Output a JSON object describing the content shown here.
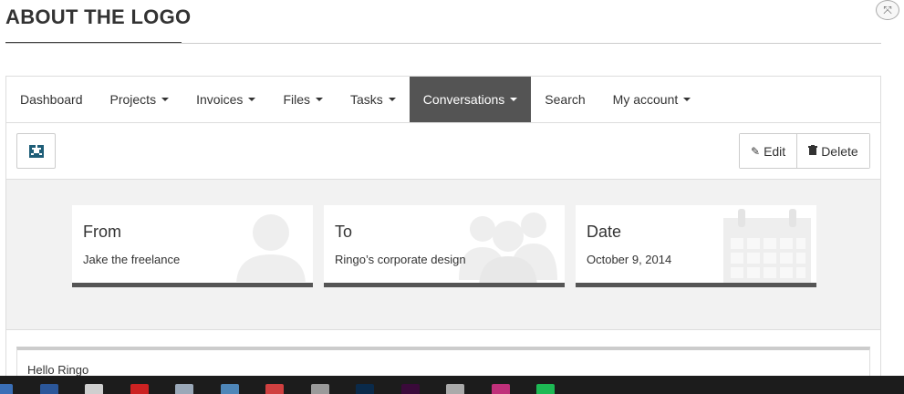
{
  "page": {
    "title": "ABOUT THE LOGO"
  },
  "nav": {
    "items": [
      {
        "label": "Dashboard",
        "dropdown": false,
        "active": false
      },
      {
        "label": "Projects",
        "dropdown": true,
        "active": false
      },
      {
        "label": "Invoices",
        "dropdown": true,
        "active": false
      },
      {
        "label": "Files",
        "dropdown": true,
        "active": false
      },
      {
        "label": "Tasks",
        "dropdown": true,
        "active": false
      },
      {
        "label": "Conversations",
        "dropdown": true,
        "active": true
      },
      {
        "label": "Search",
        "dropdown": false,
        "active": false
      },
      {
        "label": "My account",
        "dropdown": true,
        "active": false
      }
    ]
  },
  "toolbar": {
    "edit_label": "Edit",
    "delete_label": "Delete"
  },
  "stats": {
    "from": {
      "label": "From",
      "value": "Jake the freelance",
      "icon": "user-icon"
    },
    "to": {
      "label": "To",
      "value": "Ringo’s corporate design",
      "icon": "users-icon"
    },
    "date": {
      "label": "Date",
      "value": "October 9, 2014",
      "icon": "calendar-icon"
    }
  },
  "message": {
    "text": "Hello Ringo"
  },
  "colors": {
    "nav_active_bg": "#545454",
    "stats_bg": "#f2f2f2",
    "card_bar": "#555555",
    "logo_accent": "#1f5e78"
  },
  "taskbar": {
    "icons": [
      {
        "name": "app-icon",
        "color": "#3a6fb7"
      },
      {
        "name": "word-icon",
        "color": "#2b579a"
      },
      {
        "name": "notepad-icon",
        "color": "#cfcfcf"
      },
      {
        "name": "flash-icon",
        "color": "#cc2222"
      },
      {
        "name": "tool-icon",
        "color": "#9aa8b8"
      },
      {
        "name": "calculator-icon",
        "color": "#4e86b8"
      },
      {
        "name": "clock-icon",
        "color": "#d04040"
      },
      {
        "name": "network-icon",
        "color": "#9a9a9a"
      },
      {
        "name": "photoshop-icon",
        "color": "#0a2a4a"
      },
      {
        "name": "dreamweaver-icon",
        "color": "#3a0a3a"
      },
      {
        "name": "steam-icon",
        "color": "#aaaaaa"
      },
      {
        "name": "app-pink-icon",
        "color": "#c0307a"
      },
      {
        "name": "spotify-icon",
        "color": "#1db954"
      }
    ]
  }
}
